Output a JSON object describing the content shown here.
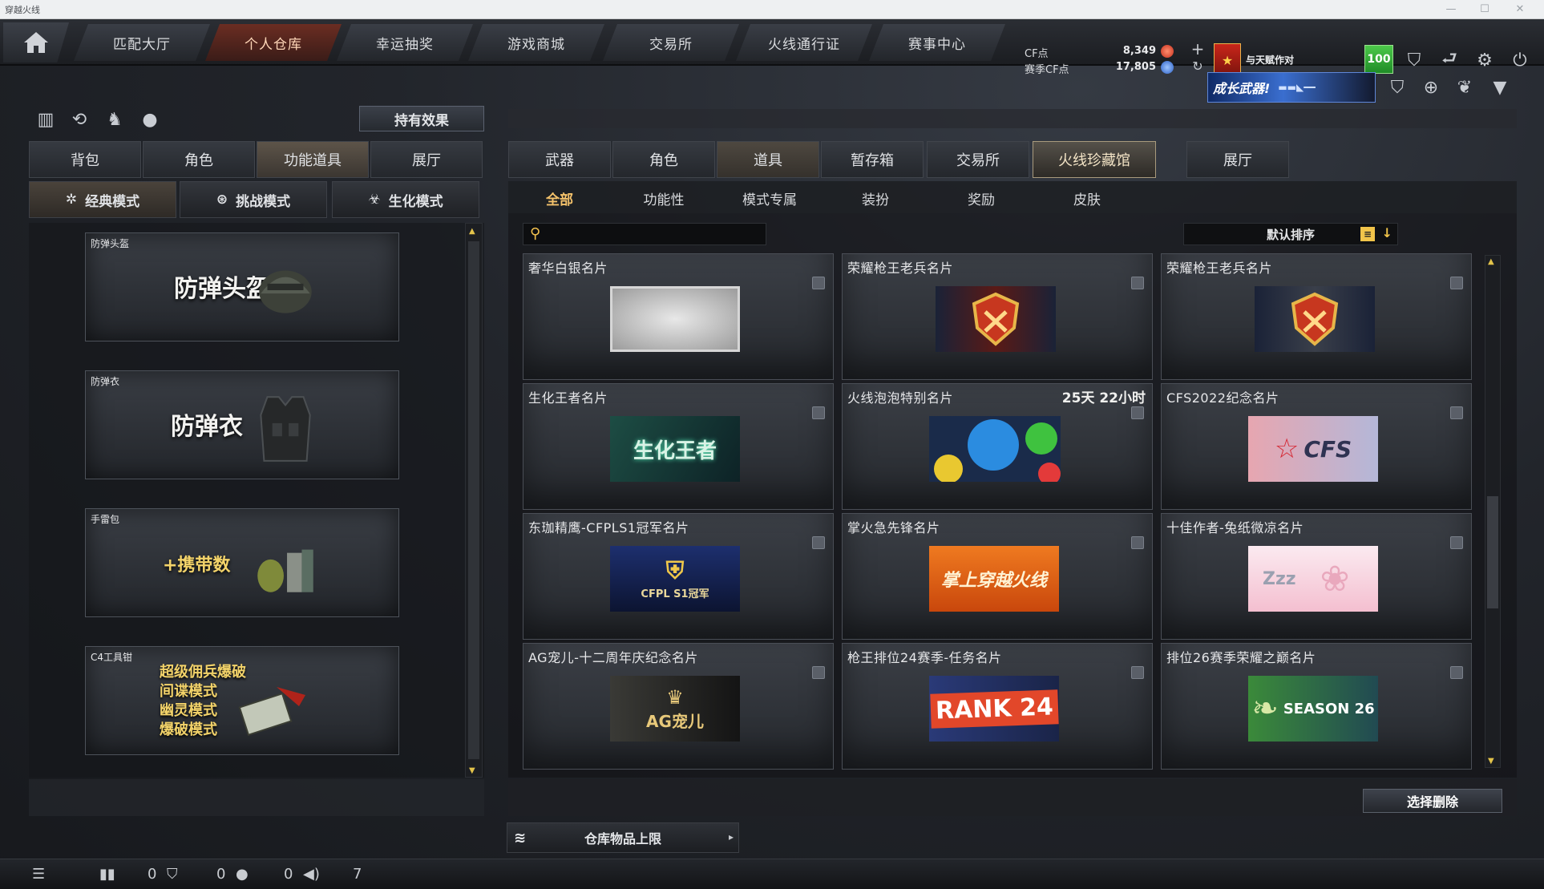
{
  "window": {
    "title": "穿越火线"
  },
  "nav": {
    "tabs": [
      {
        "label": "匹配大厅"
      },
      {
        "label": "个人仓库"
      },
      {
        "label": "幸运抽奖"
      },
      {
        "label": "游戏商城"
      },
      {
        "label": "交易所"
      },
      {
        "label": "火线通行证"
      },
      {
        "label": "赛事中心"
      }
    ],
    "cf_label": "CF点",
    "cf_value": "8,349",
    "season_label": "赛季CF点",
    "season_value": "17,805",
    "partner_label": "与天赋作对",
    "level": "100"
  },
  "promo": {
    "text": "成长武器!"
  },
  "left": {
    "effects_button": "持有效果",
    "tabs": [
      {
        "label": "背包"
      },
      {
        "label": "角色"
      },
      {
        "label": "功能道具"
      },
      {
        "label": "展厅"
      }
    ],
    "modes": [
      {
        "label": "经典模式"
      },
      {
        "label": "挑战模式"
      },
      {
        "label": "生化模式"
      }
    ],
    "items": [
      {
        "caption": "防弹头盔",
        "big": "防弹头盔"
      },
      {
        "caption": "防弹衣",
        "big": "防弹衣"
      },
      {
        "caption": "手雷包",
        "big": "+携带数"
      },
      {
        "caption": "C4工具钳",
        "lines": [
          "超级佣兵爆破",
          "间谍模式",
          "幽灵模式",
          "爆破模式"
        ]
      }
    ]
  },
  "right": {
    "tabs": [
      {
        "label": "武器"
      },
      {
        "label": "角色"
      },
      {
        "label": "道具"
      },
      {
        "label": "暂存箱"
      },
      {
        "label": "交易所"
      },
      {
        "label": "火线珍藏馆"
      },
      {
        "label": "展厅"
      }
    ],
    "subtabs": [
      {
        "label": "全部"
      },
      {
        "label": "功能性"
      },
      {
        "label": "模式专属"
      },
      {
        "label": "装扮"
      },
      {
        "label": "奖励"
      },
      {
        "label": "皮肤"
      }
    ],
    "search_placeholder": "",
    "sort_label": "默认排序",
    "cards": [
      {
        "name": "奢华白银名片",
        "time": "",
        "art": ""
      },
      {
        "name": "荣耀枪王老兵名片",
        "time": "",
        "art": ""
      },
      {
        "name": "荣耀枪王老兵名片",
        "time": "",
        "art": ""
      },
      {
        "name": "生化王者名片",
        "time": "",
        "art": "生化王者"
      },
      {
        "name": "火线泡泡特别名片",
        "time": "25天 22小时",
        "art": ""
      },
      {
        "name": "CFS2022纪念名片",
        "time": "",
        "art": "CFS"
      },
      {
        "name": "东珈精鹰-CFPLS1冠军名片",
        "time": "",
        "art": "CFPL S1冠军"
      },
      {
        "name": "掌火急先锋名片",
        "time": "",
        "art": "掌上穿越火线"
      },
      {
        "name": "十佳作者-兔纸微凉名片",
        "time": "",
        "art": "Zzz"
      },
      {
        "name": "AG宠儿-十二周年庆纪念名片",
        "time": "",
        "art": "AG宠儿"
      },
      {
        "name": "枪王排位24赛季-任务名片",
        "time": "",
        "art": "RANK 24"
      },
      {
        "name": "排位26赛季荣耀之巅名片",
        "time": "",
        "art": "SEASON 26"
      }
    ],
    "delete_button": "选择删除",
    "capacity_label": "仓库物品上限"
  },
  "bottom": {
    "count1": "0",
    "count2": "0",
    "count3": "0",
    "count4": "7"
  },
  "colors": {
    "accent": "#f4c26b",
    "active_nav": "#6b2d22",
    "level_badge": "#2fa93a"
  }
}
